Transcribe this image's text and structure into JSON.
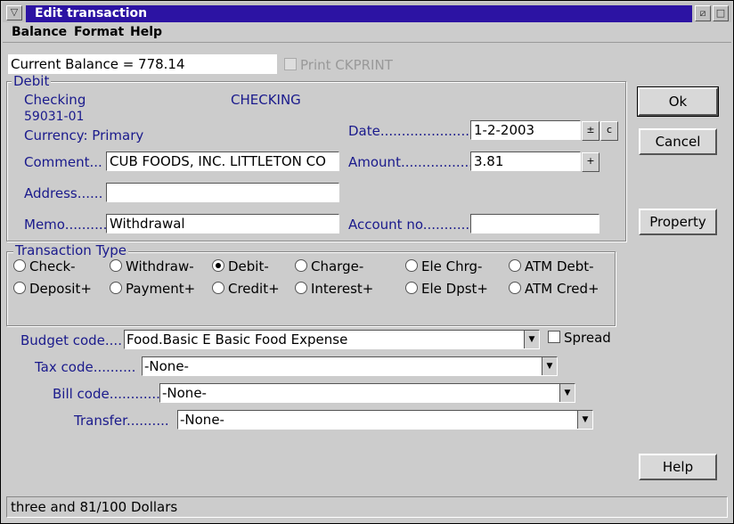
{
  "window": {
    "title": "Edit transaction"
  },
  "menu": {
    "balance": "Balance",
    "format": "Format",
    "help": "Help"
  },
  "top": {
    "current_balance": "Current Balance =  778.14",
    "print_ckprint": "Print CKPRINT"
  },
  "debit": {
    "group_label": "Debit",
    "account_name": "Checking",
    "account_number": "59031-01",
    "account_type": "CHECKING",
    "currency": "Currency: Primary",
    "comment_label": "Comment...",
    "comment_value": "CUB FOODS, INC. LITTLETON CO",
    "address_label": "Address......",
    "address_value": "",
    "memo_label": "Memo..........",
    "memo_value": "Withdrawal",
    "date_label": "Date.........................",
    "date_value": "1-2-2003",
    "amount_label": "Amount..................",
    "amount_value": "3.81",
    "account_no_label": "Account no...........",
    "account_no_value": "",
    "c_button": "c",
    "plus_button": "+"
  },
  "transaction_type": {
    "group_label": "Transaction Type",
    "row1": [
      "Check-",
      "Withdraw-",
      "Debit-",
      "Charge-",
      "Ele Chrg-",
      "ATM Debt-"
    ],
    "row2": [
      "Deposit+",
      "Payment+",
      "Credit+",
      "Interest+",
      "Ele Dpst+",
      "ATM Cred+"
    ],
    "selected": "Debit-"
  },
  "codes": {
    "budget_label": "Budget code....",
    "budget_value": "Food.Basic E Basic Food Expense",
    "spread_label": "Spread",
    "tax_label": "Tax code..........",
    "tax_value": "-None-",
    "bill_label": "Bill code............",
    "bill_value": "-None-",
    "transfer_label": "Transfer..........",
    "transfer_value": "-None-"
  },
  "buttons": {
    "ok": "Ok",
    "cancel": "Cancel",
    "property": "Property",
    "help": "Help"
  },
  "status": {
    "text": "three and 81/100 Dollars"
  },
  "colors": {
    "title_bg": "#2c13a3",
    "label_blue": "#1a1a8c",
    "window_bg": "#cccccc"
  }
}
